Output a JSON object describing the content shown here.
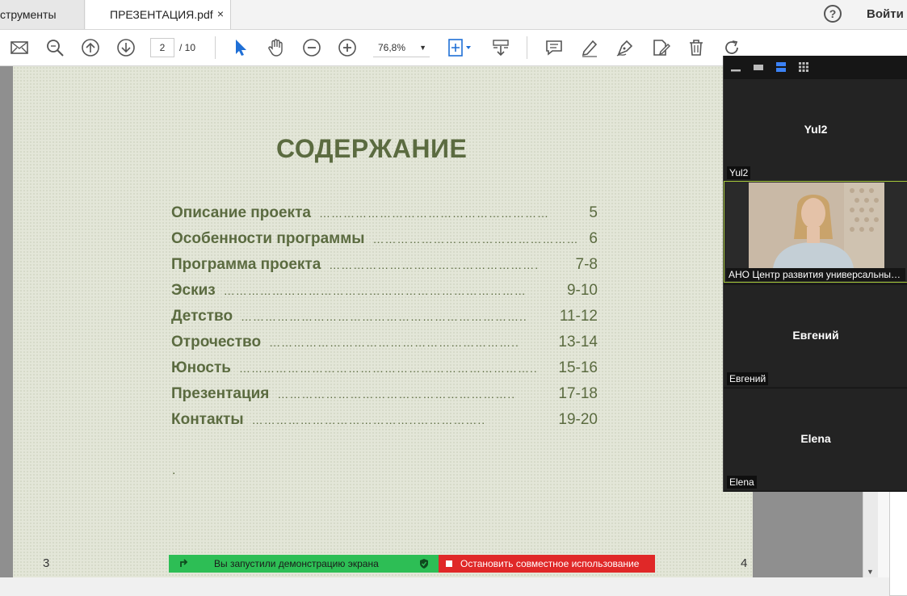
{
  "tabs": {
    "tools_label": "струменты",
    "doc_label": "ПРЕЗЕНТАЦИЯ.pdf",
    "doc_close": "×"
  },
  "header": {
    "help_glyph": "?",
    "signin_label": "Войти"
  },
  "toolbar": {
    "current_page": "2",
    "total_pages": "/ 10",
    "zoom_value": "76,8%",
    "zoom_caret": "▼"
  },
  "document": {
    "toc_title": "СОДЕРЖАНИЕ",
    "toc": [
      {
        "label": "Описание проекта",
        "dots": "…………………………………………………",
        "page": "5"
      },
      {
        "label": "Особенности программы",
        "dots": "……………………………………………",
        "page": "6"
      },
      {
        "label": "Программа проекта",
        "dots": "…………………………………………….",
        "page": " 7-8"
      },
      {
        "label": "Эскиз",
        "dots": "…………………………………………………………………",
        "page": "9-10"
      },
      {
        "label": "Детство",
        "dots": "……………………………………………………………..",
        "page": "11-12"
      },
      {
        "label": "Отрочество",
        "dots": "……………………………………………………..",
        "page": "13-14"
      },
      {
        "label": "Юность",
        "dots": "………………………………………………………………..",
        "page": "15-16"
      },
      {
        "label": "Презентация",
        "dots": "…………………………………………………..",
        "page": "17-18"
      },
      {
        "label": "Контакты",
        "dots": "…………………………………..……………..",
        "page": "19-20"
      }
    ],
    "stray_dot": ".",
    "page_num_left": "3",
    "page_num_right": "4"
  },
  "screenshare": {
    "status_text": "Вы запустили демонстрацию экрана",
    "stop_text": "Остановить совместное использование",
    "colors": {
      "green": "#2dbe55",
      "red": "#e02828"
    }
  },
  "video_panel": {
    "participants": [
      {
        "center_name": "Yul2",
        "label": "Yul2"
      },
      {
        "label": "АНО Центр развития универсальных компетенций"
      },
      {
        "center_name": "Евгений",
        "label": "Евгений"
      },
      {
        "center_name": "Elena",
        "label": "Elena"
      }
    ],
    "active_border_color": "#a6c83a"
  },
  "colors": {
    "toc_text": "#5b6b40",
    "page_bg": "#e3e6d8"
  }
}
